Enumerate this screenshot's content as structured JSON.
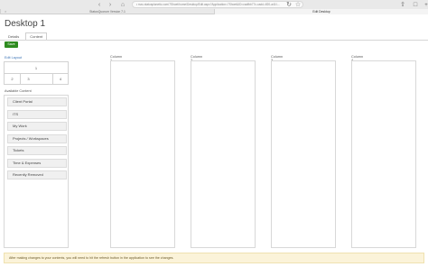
{
  "browser": {
    "url": "• rsxu.statusplanetic.com/7Shoet/home/Desktop/Edit.aspx?Application=7Shoet&ID=cadfbb77c-cadd-4f20-a41f-...",
    "tabs": [
      {
        "label": "StatusQuorum Version 7.1"
      },
      {
        "label": "Edit Desktop"
      }
    ]
  },
  "page": {
    "title": "Desktop 1",
    "tabs": [
      {
        "label": "Details"
      },
      {
        "label": "Content"
      }
    ],
    "save_label": "Save"
  },
  "layout": {
    "edit_label": "Edit Layout",
    "cells": [
      "1",
      "2",
      "3",
      "4"
    ]
  },
  "available": {
    "label": "Available Content",
    "items": [
      "Client Portal",
      "ITS",
      "My Work",
      "Projects / Workspaces",
      "Tickets",
      "Time & Expenses",
      "Recently Removed"
    ]
  },
  "columns": [
    {
      "label": "Column 1"
    },
    {
      "label": "Column 2"
    },
    {
      "label": "Column 3"
    },
    {
      "label": "Column 4"
    }
  ],
  "notice": {
    "text": "After making changes to your contents, you will need to hit the refresh button in the application to see the changes."
  },
  "colors": {
    "save_button": "#2e8b1f",
    "link": "#3a73b5",
    "notice_bg": "#fbf3d9"
  }
}
